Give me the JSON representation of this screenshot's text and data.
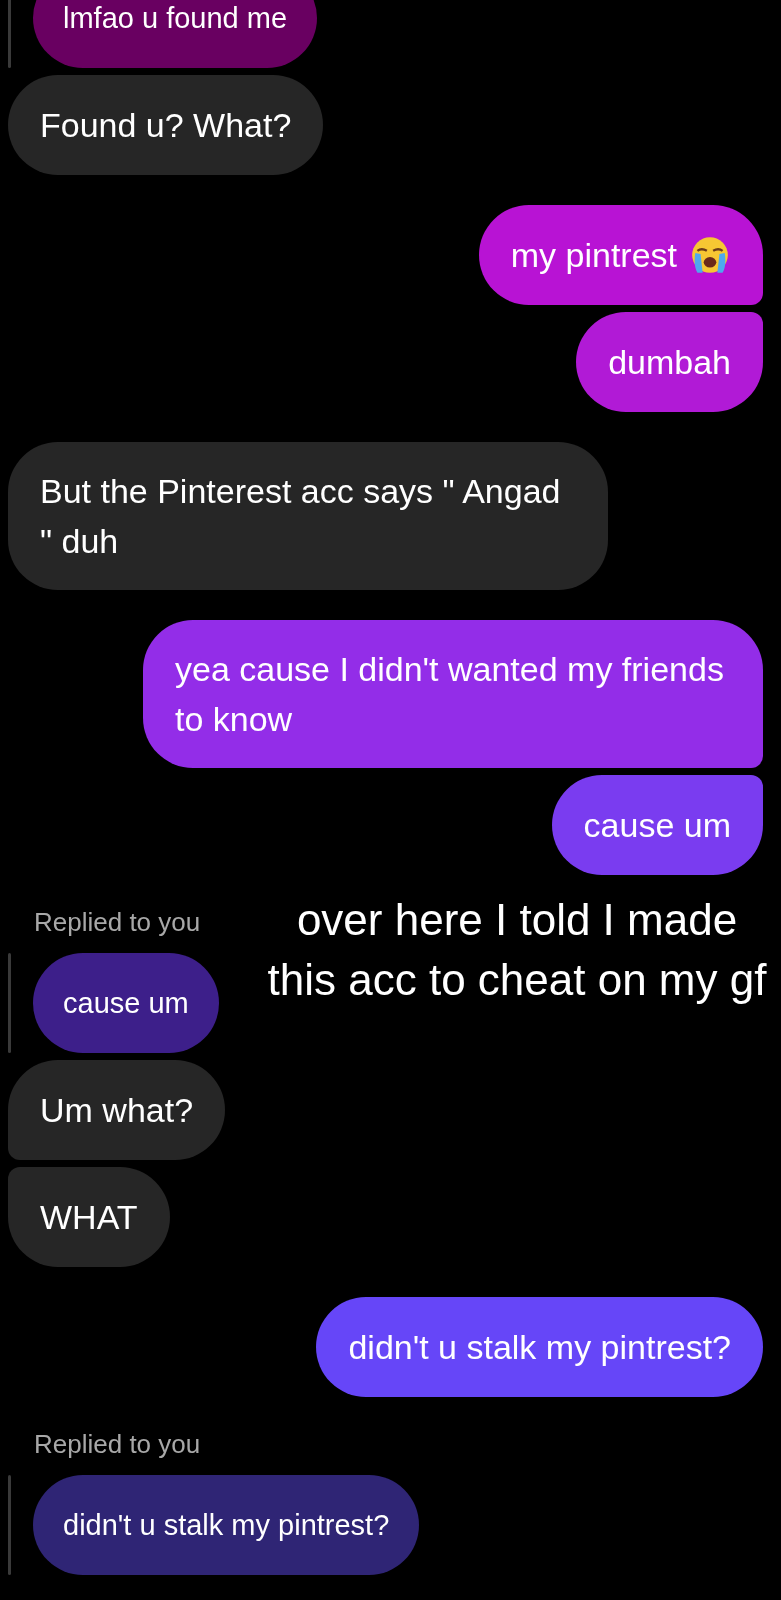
{
  "messages": [
    {
      "kind": "reply",
      "text": "lmfao u found me",
      "color": "#690061",
      "cut_top": true
    },
    {
      "kind": "received",
      "text": "Found u? What?",
      "color": "#262626"
    },
    {
      "kind": "sent",
      "text": "my pintrest",
      "color": "#b813d4",
      "trailing_icon": true
    },
    {
      "kind": "sent",
      "text": "dumbah",
      "color": "#b11ad6"
    },
    {
      "kind": "received",
      "text": "But the Pinterest acc says \" Angad \" duh",
      "color": "#262626"
    },
    {
      "kind": "sent",
      "text": "yea cause I didn't wanted my friends to know",
      "color": "#932de8"
    },
    {
      "kind": "sent",
      "text": "cause um",
      "color": "#7a3cf0"
    },
    {
      "kind": "reply",
      "label": "Replied to you",
      "text": "cause um",
      "color": "#3d1f8a"
    },
    {
      "kind": "received",
      "text": "Um what?",
      "color": "#262626"
    },
    {
      "kind": "received",
      "text": "WHAT",
      "color": "#262626"
    },
    {
      "kind": "sent",
      "text": "didn't u stalk my pintrest?",
      "color": "#6646f8"
    },
    {
      "kind": "reply",
      "label": "Replied to you",
      "text": "didn't u stalk my pintrest?",
      "color": "#2f2575"
    }
  ],
  "overlay_caption": "over here I told I made this acc to cheat on my gf"
}
